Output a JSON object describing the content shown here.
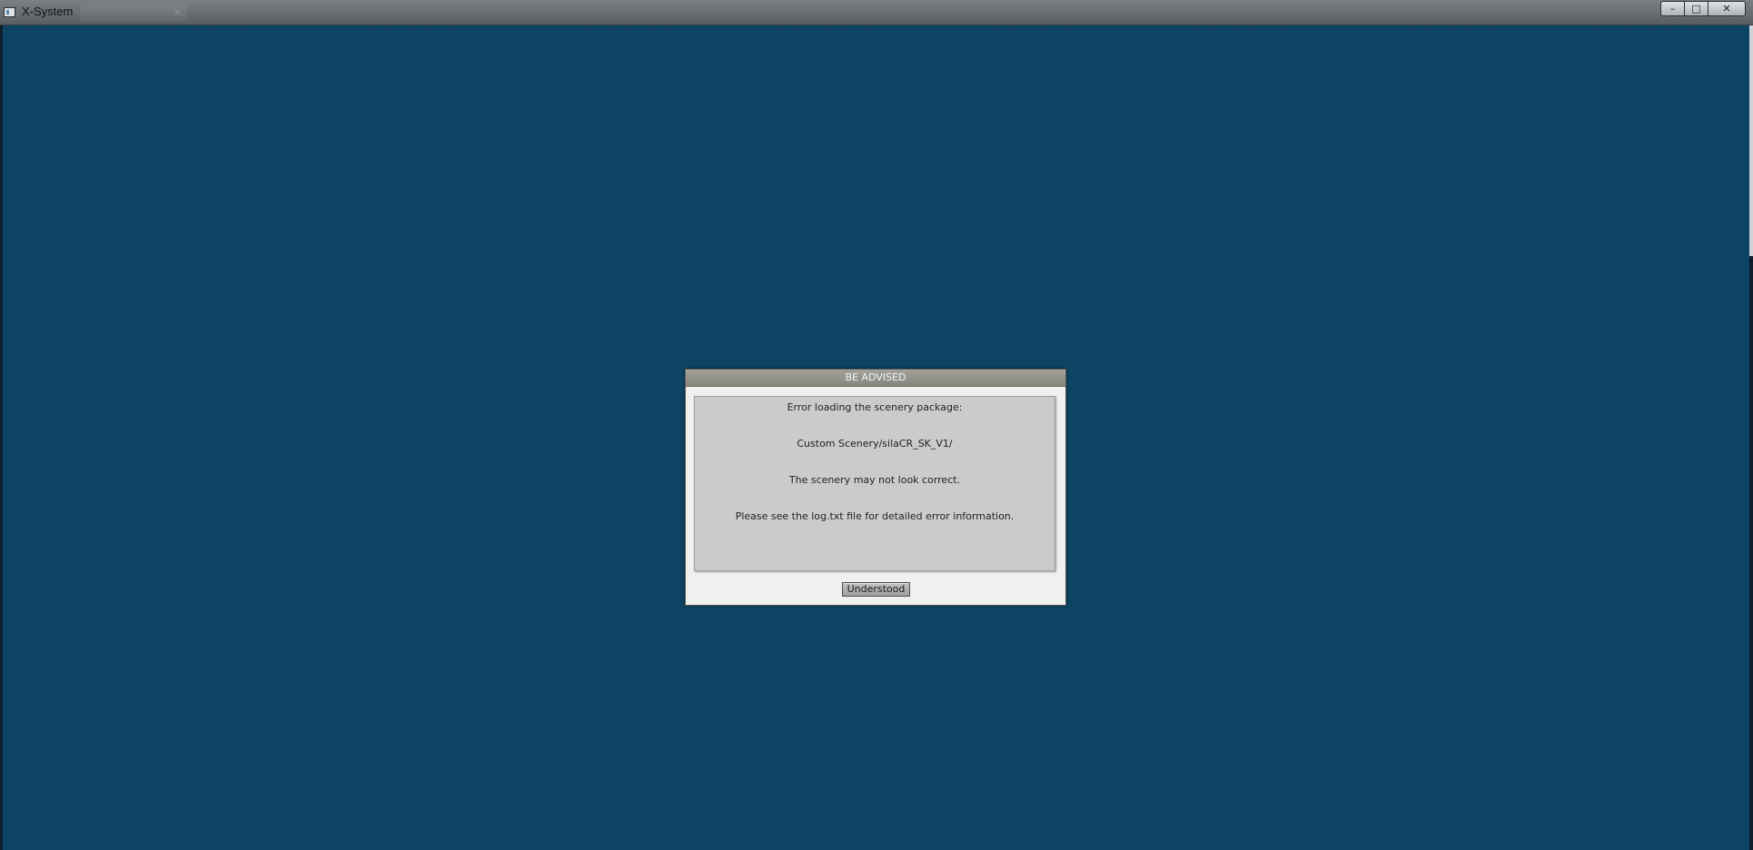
{
  "window": {
    "title": "X-System",
    "controls": {
      "minimize": "–",
      "maximize": "□",
      "close": "✕"
    }
  },
  "dialog": {
    "title": "BE ADVISED",
    "messages": [
      "Error loading the scenery package:",
      "Custom Scenery/silaCR_SK_V1/",
      "The scenery may not look correct.",
      "Please see the log.txt file for detailed error information."
    ],
    "button_label": "Understood"
  },
  "colors": {
    "background": "#0d4464",
    "dialog_header": "#8f8f87",
    "dialog_body": "#cbcbcb"
  }
}
